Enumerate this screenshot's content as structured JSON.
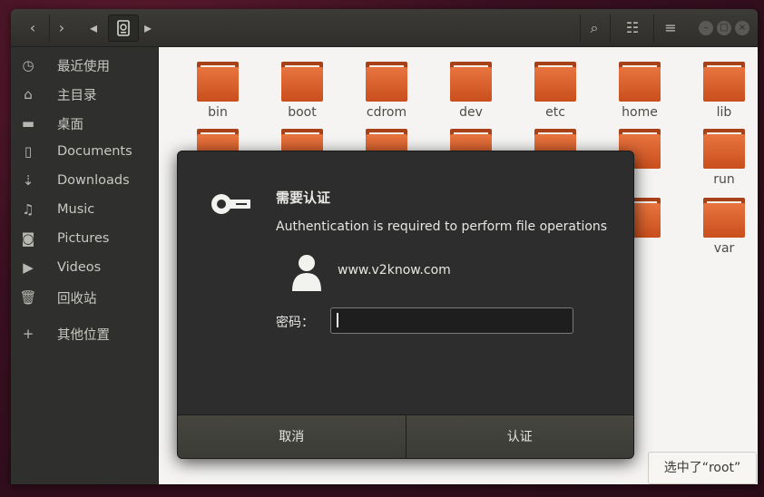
{
  "headerbar": {
    "back_icon": "‹",
    "forward_icon": "›",
    "path_prev_icon": "◂",
    "path_next_icon": "▸",
    "search_icon": "⌕",
    "view_icon": "☷",
    "menu_icon": "≡"
  },
  "sidebar": {
    "items": [
      {
        "label": "最近使用",
        "icon": "clock-icon",
        "glyph": "◷"
      },
      {
        "label": "主目录",
        "icon": "home-icon",
        "glyph": "⌂"
      },
      {
        "label": "桌面",
        "icon": "desktop-icon",
        "glyph": "▬"
      },
      {
        "label": "Documents",
        "icon": "document-icon",
        "glyph": "▯"
      },
      {
        "label": "Downloads",
        "icon": "download-icon",
        "glyph": "⇣"
      },
      {
        "label": "Music",
        "icon": "music-icon",
        "glyph": "♫"
      },
      {
        "label": "Pictures",
        "icon": "camera-icon",
        "glyph": "◙"
      },
      {
        "label": "Videos",
        "icon": "video-icon",
        "glyph": "▶"
      },
      {
        "label": "回收站",
        "icon": "trash-icon",
        "glyph": "🗑"
      },
      {
        "label": "其他位置",
        "icon": "plus-icon",
        "glyph": "+"
      }
    ]
  },
  "folders": [
    {
      "label": "bin"
    },
    {
      "label": "boot"
    },
    {
      "label": "cdrom"
    },
    {
      "label": "dev"
    },
    {
      "label": "etc"
    },
    {
      "label": "home"
    },
    {
      "label": "lib"
    },
    {
      "label": "run"
    },
    {
      "label": "var"
    }
  ],
  "status": {
    "selected": "选中了“root”"
  },
  "dialog": {
    "title": "需要认证",
    "message": "Authentication is required to perform file operations",
    "user": "www.v2know.com",
    "password_label": "密码：",
    "password_value": "",
    "cancel_label": "取消",
    "auth_label": "认证"
  },
  "colors": {
    "folder": "#e06a32",
    "dialog_bg": "#2d2d2d",
    "accent": "#e95420"
  }
}
